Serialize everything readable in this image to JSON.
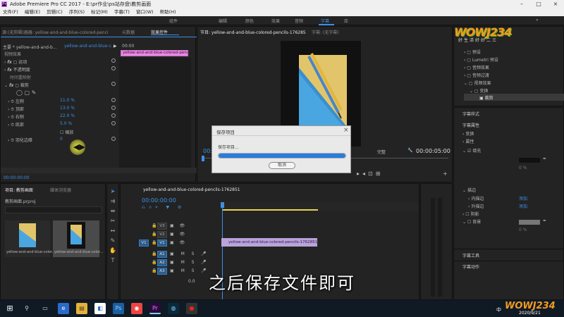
{
  "app": {
    "title": "Adobe Premiere Pro CC 2017 - E:\\pr作业\\ps站存盘\\教剪画面",
    "icon_label": "Pr"
  },
  "menu": [
    "文件(F)",
    "编辑(E)",
    "剪辑(C)",
    "序列(S)",
    "标记(M)",
    "字幕(T)",
    "窗口(W)",
    "帮助(H)"
  ],
  "workspaces": {
    "items": [
      "组件",
      "编辑",
      "颜色",
      "效果",
      "音频",
      "字幕",
      "库"
    ],
    "active": "字幕"
  },
  "effect_controls": {
    "tabs": [
      "源:(无剪辑)器器: yellow-and-and-blue-colored-pencils-1762851.jpg",
      "元数据",
      "效果控件"
    ],
    "header": "主要 * yellow-and-and-b...",
    "clip": "yellow-and-and-blue-c...",
    "clip_bar_label": "yellow-and-and-blue-colored-pencils",
    "timecode_start": "00:00",
    "section": "视频效果",
    "motion": "运动",
    "opacity": "不透明度",
    "time_remap": "时间重映射",
    "crop": "裁剪",
    "props": [
      {
        "label": "左侧",
        "value": "11.0 %"
      },
      {
        "label": "顶部",
        "value": "13.0 %"
      },
      {
        "label": "右侧",
        "value": "22.0 %"
      },
      {
        "label": "底部",
        "value": "5.0 %"
      }
    ],
    "zoom_label": "缩放",
    "feather_label": "羽化边缘",
    "feather_value": "0",
    "timecode": "00:00:00:00"
  },
  "program": {
    "tabs": [
      "节目: yellow-and-and-blue-colored-pencils-1762851",
      "字幕: (无字幕)"
    ],
    "timecode": "00:00:00:00",
    "fit": "完整",
    "duration": "00:00:05:00"
  },
  "dialog": {
    "title": "保存项目",
    "message": "保存项目...",
    "progress": 1.0,
    "cancel": "取消"
  },
  "project": {
    "tabs": [
      "项目: 教剪画面",
      "媒体浏览器"
    ],
    "file": "教剪画面.prproj",
    "items": [
      {
        "name": "yellow-and-and-blue-color...",
        "dur": "5:00"
      },
      {
        "name": "yellow-and-and-blue-color...",
        "dur": "5:00"
      }
    ]
  },
  "timeline": {
    "tab": "yellow-and-and-blue-colored-pencils-1762851",
    "timecode": "00:00:00:00",
    "tracks_video": [
      "V3",
      "V2",
      "V1"
    ],
    "tracks_audio": [
      "A1",
      "A2",
      "A3"
    ],
    "source_patch_v": "V1",
    "source_patch_a": "A1",
    "clip": "yellow-and-and-blue-colored-pencils-1762851.jpg",
    "master_label": "主声道",
    "master_value": "0.0"
  },
  "effects_panel": {
    "logo_text": "WOWJ234",
    "logo_sub": "好生活好好二三",
    "items": [
      "预设",
      "Lumetri 预设",
      "音频效果",
      "音频过渡",
      "视频效果",
      "变换",
      "裁剪"
    ]
  },
  "title_props": {
    "sections": [
      "字幕样式",
      "字幕属性"
    ],
    "rows": [
      "变换",
      "属性",
      "填充",
      "描边",
      "内描边",
      "外描边",
      "阴影",
      "背景"
    ],
    "add_labels": [
      "添加",
      "添加"
    ],
    "pct": [
      "0 %",
      "0 %",
      "0 %"
    ],
    "fill_label": "填充",
    "tools": "字幕工具",
    "actions": "字幕动作"
  },
  "taskbar": {
    "time": "",
    "date": "2020/9/21",
    "lang": "中"
  },
  "subtitle": "之后保存文件即可",
  "watermark": "WOWJ234",
  "colors": {
    "accent": "#3d8fe6",
    "clip_pink": "#e68ae0",
    "clip_purple": "#b9a3d9",
    "progress": "#2b7cdb"
  }
}
